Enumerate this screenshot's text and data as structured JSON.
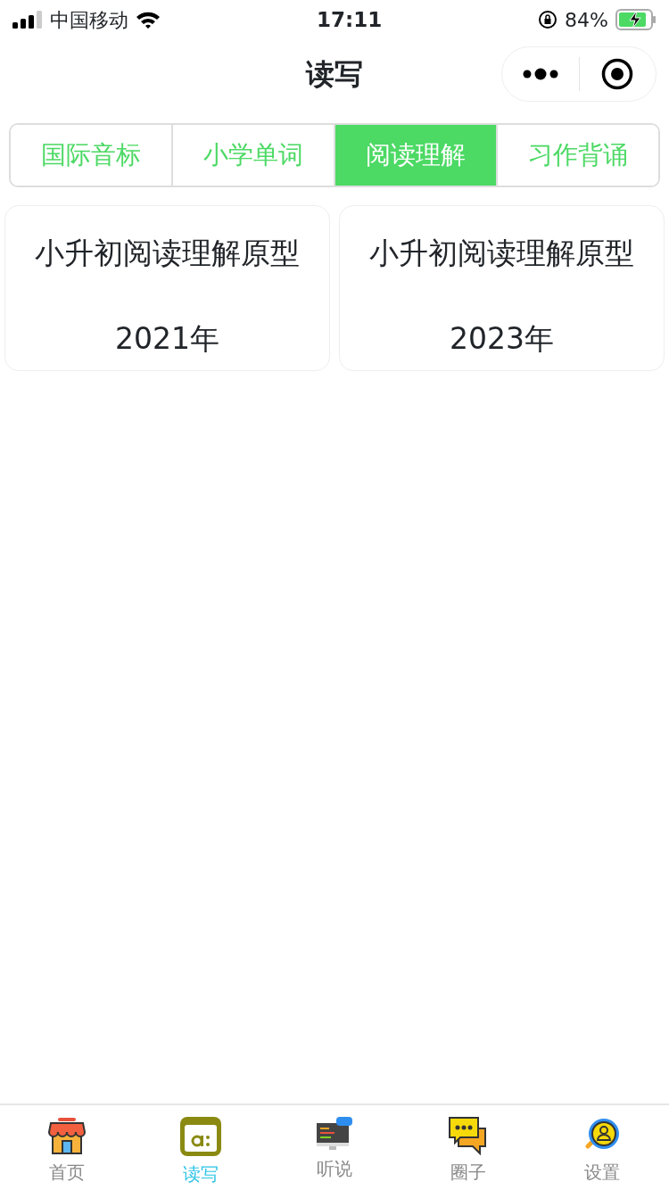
{
  "status_bar": {
    "carrier": "中国移动",
    "time": "17:11",
    "battery": "84%"
  },
  "nav_bar": {
    "title": "读写"
  },
  "tabs": [
    {
      "label": "国际音标",
      "selected": false
    },
    {
      "label": "小学单词",
      "selected": false
    },
    {
      "label": "阅读理解",
      "selected": true
    },
    {
      "label": "习作背诵",
      "selected": false
    }
  ],
  "cards": [
    {
      "title": "小升初阅读理解原型",
      "year": "2021年"
    },
    {
      "title": "小升初阅读理解原型",
      "year": "2023年"
    }
  ],
  "tab_bar": [
    {
      "label": "首页",
      "kind": "shop",
      "selected": false
    },
    {
      "label": "读写",
      "kind": "read",
      "selected": true
    },
    {
      "label": "听说",
      "kind": "monitor",
      "selected": false
    },
    {
      "label": "圈子",
      "kind": "chat",
      "selected": false
    },
    {
      "label": "设置",
      "kind": "user",
      "selected": false
    }
  ]
}
